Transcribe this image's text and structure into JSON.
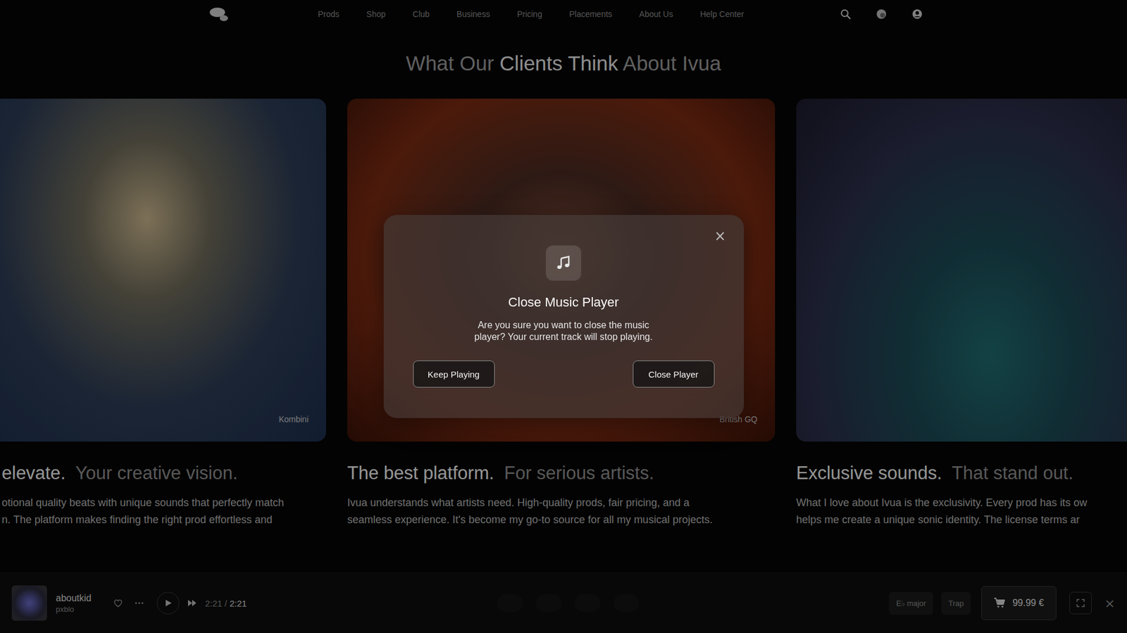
{
  "nav": {
    "items": [
      "Prods",
      "Shop",
      "Club",
      "Business",
      "Pricing",
      "Placements",
      "About Us",
      "Help Center"
    ]
  },
  "heading": [
    {
      "text": "What Our ",
      "highlight": false
    },
    {
      "text": "Clients Think",
      "highlight": true
    },
    {
      "text": " About Ivua",
      "highlight": false
    }
  ],
  "testimonials": [
    {
      "caption": "Kombini",
      "title": "elevate.",
      "subtitle": "Your creative vision.",
      "lines": [
        "otional quality beats with unique sounds that perfectly match",
        "n. The platform makes finding the right prod effortless and"
      ]
    },
    {
      "caption": "British GQ",
      "title": "The best platform.",
      "subtitle": "For serious artists.",
      "lines": [
        "Ivua understands what artists need. High-quality prods, fair pricing, and a",
        "seamless experience. It's become my go-to source for all my musical projects."
      ]
    },
    {
      "caption": "",
      "title": "Exclusive sounds.",
      "subtitle": "That stand out.",
      "lines": [
        "What I love about Ivua is the exclusivity. Every prod has its ow",
        "helps me create a unique sonic identity. The license terms ar"
      ]
    }
  ],
  "modal": {
    "close": "×",
    "title": "Close Music Player",
    "message": "Are you sure you want to close the music player? Your current track will stop playing.",
    "buttons": [
      "Keep Playing",
      "Close Player"
    ]
  },
  "player": {
    "title": "aboutkid",
    "artist": "pxblo",
    "elapsed": "2:21",
    "separator": " / ",
    "duration": "2:21",
    "key": "E♭ major",
    "genre": "Trap",
    "price": "99.99 €",
    "close": "×"
  }
}
